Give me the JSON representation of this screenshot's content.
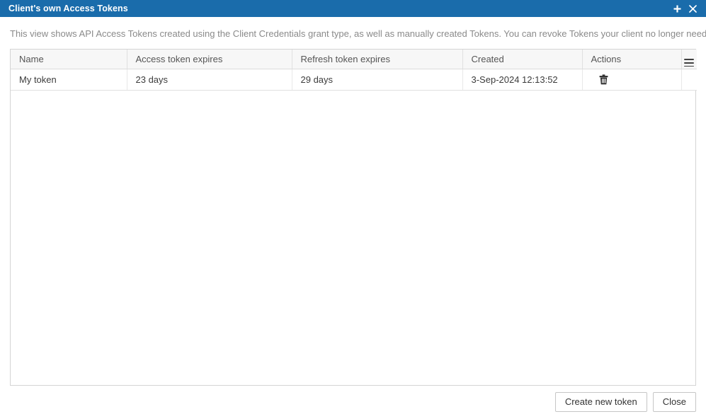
{
  "window": {
    "title": "Client's own Access Tokens",
    "accent_color": "#1a6cab",
    "add_icon": "plus-icon",
    "close_icon": "close-icon"
  },
  "description": "This view shows API Access Tokens created using the Client Credentials grant type, as well as manually created Tokens. You can revoke Tokens your client no longer needs.",
  "table": {
    "columns": [
      {
        "label": "Name"
      },
      {
        "label": "Access token expires"
      },
      {
        "label": "Refresh token expires"
      },
      {
        "label": "Created"
      },
      {
        "label": "Actions"
      }
    ],
    "column_menu_icon": "hamburger-menu-icon",
    "rows": [
      {
        "name": "My token",
        "access_token_expires": "23 days",
        "refresh_token_expires": "29 days",
        "created": "3-Sep-2024 12:13:52",
        "action_icon": "trash-icon"
      }
    ]
  },
  "footer": {
    "create_label": "Create new token",
    "close_label": "Close"
  }
}
